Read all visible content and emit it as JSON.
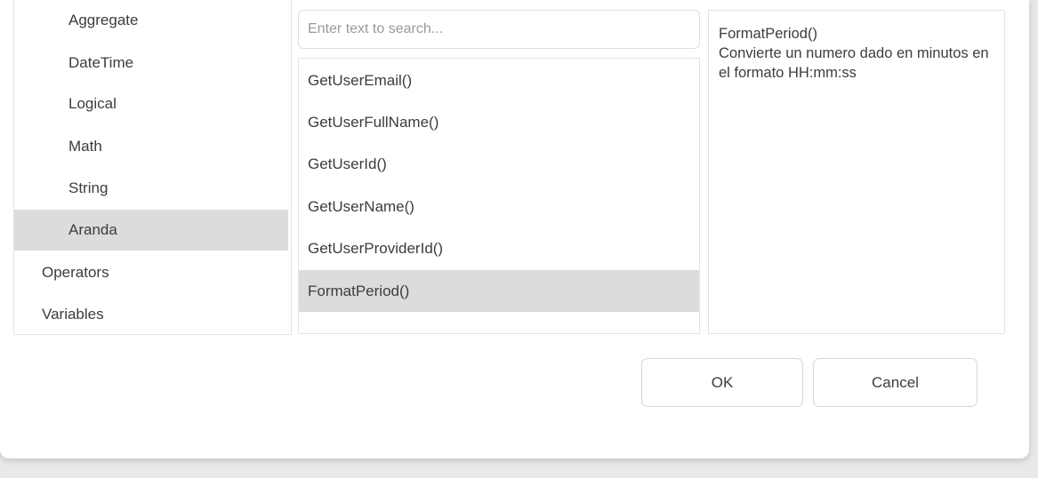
{
  "categories": {
    "items": [
      {
        "label": "Aggregate",
        "level": "child"
      },
      {
        "label": "DateTime",
        "level": "child"
      },
      {
        "label": "Logical",
        "level": "child"
      },
      {
        "label": "Math",
        "level": "child"
      },
      {
        "label": "String",
        "level": "child"
      },
      {
        "label": "Aranda",
        "level": "child",
        "selected": true
      },
      {
        "label": "Operators",
        "level": "root"
      },
      {
        "label": "Variables",
        "level": "root"
      }
    ]
  },
  "search": {
    "placeholder": "Enter text to search...",
    "value": ""
  },
  "functions": {
    "items": [
      {
        "label": "GetUserEmail()"
      },
      {
        "label": "GetUserFullName()"
      },
      {
        "label": "GetUserId()"
      },
      {
        "label": "GetUserName()"
      },
      {
        "label": "GetUserProviderId()"
      },
      {
        "label": "FormatPeriod()",
        "selected": true
      },
      {
        "label": "",
        "partial": true
      }
    ]
  },
  "description": {
    "title": "FormatPeriod()",
    "text": "Convierte un numero dado en minutos en el formato HH:mm:ss"
  },
  "buttons": {
    "ok_label": "OK",
    "cancel_label": "Cancel"
  },
  "colors": {
    "selected_background": "#dcdcdc",
    "border": "#e3e3e3",
    "text": "#3c3c3c",
    "placeholder": "#9a9a9a"
  }
}
